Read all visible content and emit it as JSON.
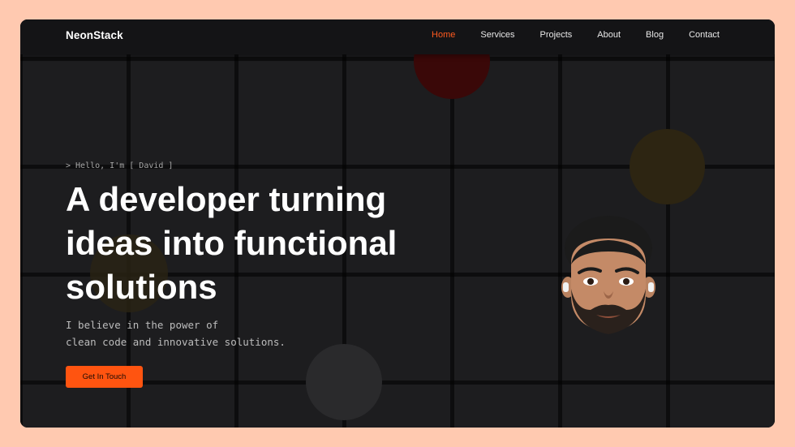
{
  "header": {
    "brand": "NeonStack",
    "nav": [
      {
        "label": "Home",
        "active": true
      },
      {
        "label": "Services",
        "active": false
      },
      {
        "label": "Projects",
        "active": false
      },
      {
        "label": "About",
        "active": false
      },
      {
        "label": "Blog",
        "active": false
      },
      {
        "label": "Contact",
        "active": false
      }
    ]
  },
  "hero": {
    "greeting": "> Hello, I'm [ David ]",
    "headline_lines": [
      "A developer turning",
      "ideas into functional",
      "solutions"
    ],
    "subtext_lines": [
      "I believe in the power of",
      "clean code and innovative solutions."
    ],
    "cta_label": "Get In Touch"
  },
  "colors": {
    "accent": "#ff5410",
    "page_background": "#FFC9B0",
    "panel_background": "#1c1c1e"
  },
  "icons": {
    "avatar": "memoji-avatar"
  }
}
